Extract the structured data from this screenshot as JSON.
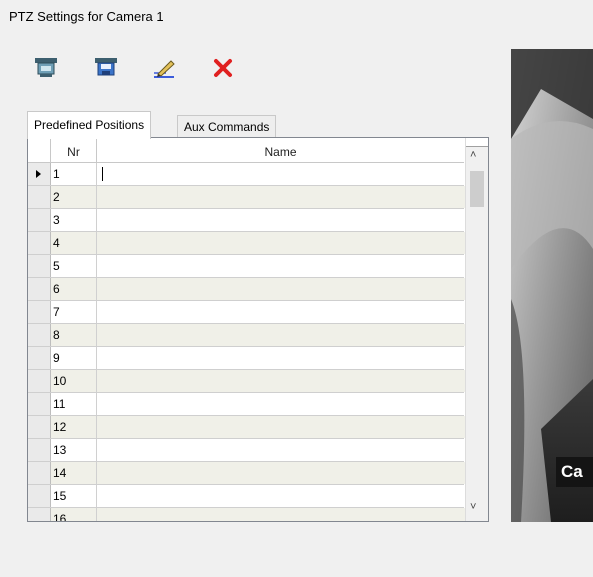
{
  "window": {
    "title": "PTZ Settings for Camera 1"
  },
  "toolbar": {
    "buttons": [
      {
        "icon": "camera-preset-icon"
      },
      {
        "icon": "save-preset-icon"
      },
      {
        "icon": "edit-icon"
      },
      {
        "icon": "delete-icon",
        "color": "#e02020"
      }
    ]
  },
  "tabs": [
    {
      "label": "Predefined Positions",
      "active": true
    },
    {
      "label": "Aux Commands",
      "active": false
    }
  ],
  "table": {
    "columns": [
      "Nr",
      "Name"
    ],
    "rows": [
      {
        "nr": "1",
        "name": ""
      },
      {
        "nr": "2",
        "name": ""
      },
      {
        "nr": "3",
        "name": ""
      },
      {
        "nr": "4",
        "name": ""
      },
      {
        "nr": "5",
        "name": ""
      },
      {
        "nr": "6",
        "name": ""
      },
      {
        "nr": "7",
        "name": ""
      },
      {
        "nr": "8",
        "name": ""
      },
      {
        "nr": "9",
        "name": ""
      },
      {
        "nr": "10",
        "name": ""
      },
      {
        "nr": "11",
        "name": ""
      },
      {
        "nr": "12",
        "name": ""
      },
      {
        "nr": "13",
        "name": ""
      },
      {
        "nr": "14",
        "name": ""
      },
      {
        "nr": "15",
        "name": ""
      },
      {
        "nr": "16",
        "name": ""
      }
    ],
    "selected_row": "1"
  },
  "video": {
    "label": "Ca"
  }
}
